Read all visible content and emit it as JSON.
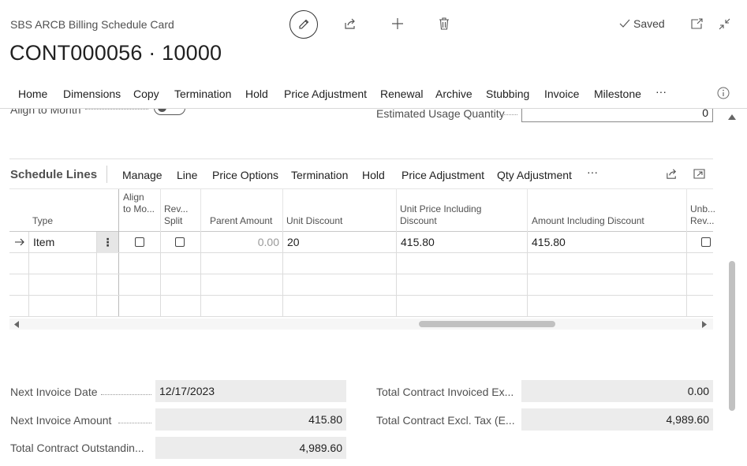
{
  "header": {
    "caption": "SBS ARCB Billing Schedule Card",
    "title": "CONT000056 · 10000",
    "saved_label": "Saved",
    "icons": [
      "pencil-icon",
      "share-icon",
      "plus-icon",
      "trash-icon",
      "checkmark-icon",
      "open-new-window-icon",
      "collapse-icon"
    ]
  },
  "action_bar": {
    "items": [
      "Home",
      "Dimensions",
      "Copy",
      "Termination",
      "Hold",
      "Price Adjustment",
      "Renewal",
      "Archive",
      "Stubbing",
      "Invoice",
      "Milestone"
    ],
    "more": "···",
    "info_icon": "info-icon"
  },
  "general": {
    "align_to_month_label": "Align to Month",
    "align_to_month_value": false,
    "estimated_usage_label": "Estimated Usage Quantity",
    "estimated_usage_value": "0"
  },
  "schedule_lines": {
    "title": "Schedule Lines",
    "actions": [
      "Manage",
      "Line",
      "Price Options",
      "Termination",
      "Hold",
      "Price Adjustment",
      "Qty Adjustment"
    ],
    "more": "···",
    "columns": [
      {
        "label": "Type"
      },
      {
        "label": "Align to Mo..."
      },
      {
        "label": "Rev... Split"
      },
      {
        "label": "Parent Amount"
      },
      {
        "label": "Unit Discount"
      },
      {
        "label": "Unit Price Including Discount"
      },
      {
        "label": "Amount Including Discount"
      },
      {
        "label": "Unb... Rev..."
      }
    ],
    "rows": [
      {
        "type": "Item",
        "align_to_month": false,
        "rev_split": false,
        "parent_amount": "0.00",
        "unit_discount": "20",
        "unit_price_incl_discount": "415.80",
        "amount_incl_discount": "415.80",
        "unbilled_rev": false
      }
    ],
    "empty_rows": 3
  },
  "facts": {
    "left": [
      {
        "label": "Next Invoice Date",
        "value": "12/17/2023"
      },
      {
        "label": "Next Invoice Amount",
        "value": "415.80"
      },
      {
        "label": "Total Contract Outstandin...",
        "value": "4,989.60"
      }
    ],
    "right": [
      {
        "label": "Total Contract Invoiced Ex...",
        "value": "0.00"
      },
      {
        "label": "Total Contract Excl. Tax (E...",
        "value": "4,989.60"
      }
    ]
  }
}
